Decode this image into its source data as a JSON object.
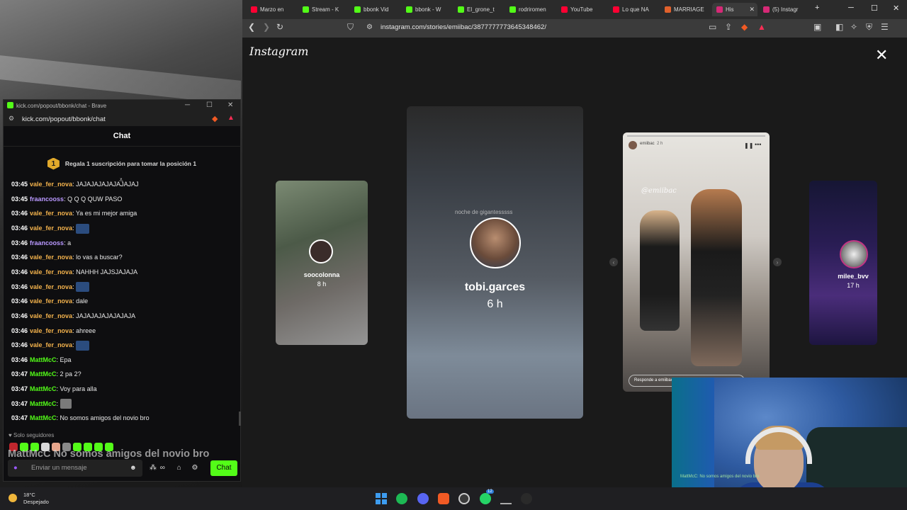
{
  "browser": {
    "tabs": [
      {
        "label": "Marzo en",
        "color": "#ff0033"
      },
      {
        "label": "Stream - K",
        "color": "#53fc18"
      },
      {
        "label": "bbonk Vid",
        "color": "#53fc18"
      },
      {
        "label": "bbonk - W",
        "color": "#53fc18"
      },
      {
        "label": "El_grone_t",
        "color": "#53fc18"
      },
      {
        "label": "rodriromen",
        "color": "#53fc18"
      },
      {
        "label": "YouTube",
        "color": "#ff0033"
      },
      {
        "label": "Lo que NA",
        "color": "#ff0033"
      },
      {
        "label": "MARRIAGE",
        "color": "#e0612c"
      },
      {
        "label": "His",
        "color": "#d62976"
      },
      {
        "label": "(5) Instagr",
        "color": "#d62976"
      }
    ],
    "url": "instagram.com/stories/emiibac/3877777773645348462/",
    "new_tab": "+",
    "controls": {
      "minimize": "─",
      "maximize": "☐",
      "close": "✕"
    }
  },
  "instagram": {
    "logo": "Instagram",
    "close": "✕",
    "stories": [
      {
        "username": "soocolonna",
        "time": "8 h"
      },
      {
        "username": "tobi.garces",
        "time": "6 h",
        "overlay_text": "noche de gigantesssss"
      },
      {
        "username": "emiibac",
        "time": "2 h",
        "sticker": "@emiibac",
        "reply_placeholder": "Responde a emiibac..."
      },
      {
        "username": "milee_bvv",
        "time": "17 h"
      }
    ],
    "prev": "‹",
    "next": "›"
  },
  "kick": {
    "window_title": "kick.com/popout/bbonk/chat - Brave",
    "url": "kick.com/popout/bbonk/chat",
    "header": "Chat",
    "sub_banner": "Regala 1 suscripción para tomar la posición 1",
    "sub_rank": "1",
    "messages": [
      {
        "time": "03:45",
        "user": "vale_fer_nova",
        "color": "#f3b24c",
        "text": "JAJAJAJAJAJAJAJAJ",
        "emote": false
      },
      {
        "time": "03:45",
        "user": "fraancooss",
        "color": "#b998ff",
        "text": "Q Q Q QUW PASO",
        "emote": false
      },
      {
        "time": "03:46",
        "user": "vale_fer_nova",
        "color": "#f3b24c",
        "text": "Ya es mi mejor amiga",
        "emote": false
      },
      {
        "time": "03:46",
        "user": "vale_fer_nova",
        "color": "#f3b24c",
        "text": "",
        "emote": true
      },
      {
        "time": "03:46",
        "user": "fraancooss",
        "color": "#b998ff",
        "text": "a",
        "emote": false
      },
      {
        "time": "03:46",
        "user": "vale_fer_nova",
        "color": "#f3b24c",
        "text": "lo vas a buscar?",
        "emote": false
      },
      {
        "time": "03:46",
        "user": "vale_fer_nova",
        "color": "#f3b24c",
        "text": "NAHHH JAJSJAJAJA",
        "emote": false
      },
      {
        "time": "03:46",
        "user": "vale_fer_nova",
        "color": "#f3b24c",
        "text": "",
        "emote": true
      },
      {
        "time": "03:46",
        "user": "vale_fer_nova",
        "color": "#f3b24c",
        "text": "dale",
        "emote": false
      },
      {
        "time": "03:46",
        "user": "vale_fer_nova",
        "color": "#f3b24c",
        "text": "JAJAJAJAJAJAJAJA",
        "emote": false
      },
      {
        "time": "03:46",
        "user": "vale_fer_nova",
        "color": "#f3b24c",
        "text": "ahreee",
        "emote": false
      },
      {
        "time": "03:46",
        "user": "vale_fer_nova",
        "color": "#f3b24c",
        "text": "",
        "emote": true
      },
      {
        "time": "03:46",
        "user": "MattMcC",
        "color": "#53fc18",
        "text": "Epa",
        "emote": false
      },
      {
        "time": "03:47",
        "user": "MattMcC",
        "color": "#53fc18",
        "text": "2 pa 2?",
        "emote": false
      },
      {
        "time": "03:47",
        "user": "MattMcC",
        "color": "#53fc18",
        "text": "Voy para alla",
        "emote": false
      },
      {
        "time": "03:47",
        "user": "MattMcC",
        "color": "#53fc18",
        "text": "",
        "emote": true
      },
      {
        "time": "03:47",
        "user": "MattMcC",
        "color": "#53fc18",
        "text": "No somos amigos del novio bro",
        "emote": false
      }
    ],
    "followers_only": "Solo seguidores",
    "overlay_message": "MattMcC No somos amigos del novio bro",
    "input_placeholder": "Enviar un mensaje",
    "send_label": "Chat"
  },
  "webcam": {
    "chat_overlay": "MattMcC: No somos amigos del novio bro"
  },
  "taskbar": {
    "temperature": "18°C",
    "condition": "Despejado",
    "whatsapp_badge": "12"
  }
}
